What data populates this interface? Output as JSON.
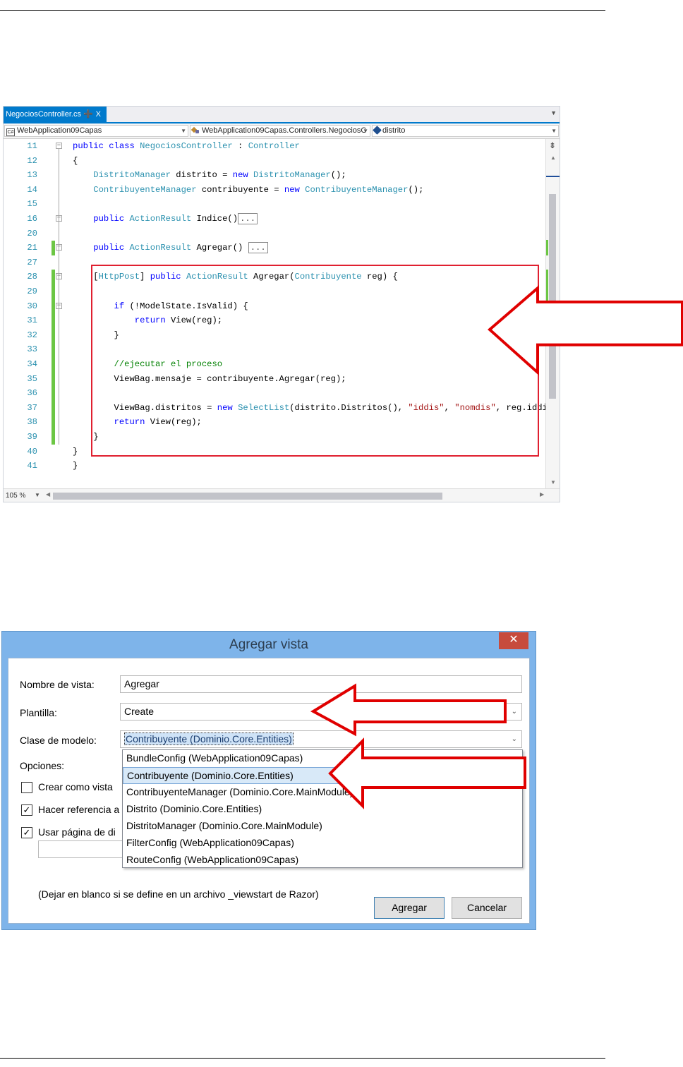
{
  "editor": {
    "tab": {
      "filename": "NegociosController.cs",
      "pin": "➕",
      "close": "X"
    },
    "nav": {
      "project": "WebApplication09Capas",
      "class": "WebApplication09Capas.Controllers.NegociosC",
      "member": "distrito"
    },
    "zoom": "105 %",
    "lines": [
      {
        "n": "11",
        "segments": [
          {
            "t": "public class ",
            "c": "kw"
          },
          {
            "t": "NegociosController",
            "c": "ty"
          },
          {
            "t": " : ",
            "c": ""
          },
          {
            "t": "Controller",
            "c": "ty"
          }
        ]
      },
      {
        "n": "12",
        "segments": [
          {
            "t": "{",
            "c": ""
          }
        ]
      },
      {
        "n": "13",
        "segments": [
          {
            "t": "    ",
            "c": ""
          },
          {
            "t": "DistritoManager",
            "c": "ty"
          },
          {
            "t": " distrito = ",
            "c": ""
          },
          {
            "t": "new ",
            "c": "kw"
          },
          {
            "t": "DistritoManager",
            "c": "ty"
          },
          {
            "t": "();",
            "c": ""
          }
        ]
      },
      {
        "n": "14",
        "segments": [
          {
            "t": "    ",
            "c": ""
          },
          {
            "t": "ContribuyenteManager",
            "c": "ty"
          },
          {
            "t": " contribuyente = ",
            "c": ""
          },
          {
            "t": "new ",
            "c": "kw"
          },
          {
            "t": "ContribuyenteManager",
            "c": "ty"
          },
          {
            "t": "();",
            "c": ""
          }
        ]
      },
      {
        "n": "15",
        "segments": []
      },
      {
        "n": "16",
        "segments": [
          {
            "t": "    ",
            "c": ""
          },
          {
            "t": "public ",
            "c": "kw"
          },
          {
            "t": "ActionResult",
            "c": "ty"
          },
          {
            "t": " Indice()",
            "c": ""
          },
          {
            "t": "...",
            "c": "collapsed"
          }
        ]
      },
      {
        "n": "20",
        "segments": []
      },
      {
        "n": "21",
        "segments": [
          {
            "t": "    ",
            "c": ""
          },
          {
            "t": "public ",
            "c": "kw"
          },
          {
            "t": "ActionResult",
            "c": "ty"
          },
          {
            "t": " Agregar() ",
            "c": ""
          },
          {
            "t": "...",
            "c": "collapsed"
          }
        ]
      },
      {
        "n": "27",
        "segments": []
      },
      {
        "n": "28",
        "segments": [
          {
            "t": "    [",
            "c": ""
          },
          {
            "t": "HttpPost",
            "c": "ty"
          },
          {
            "t": "] ",
            "c": ""
          },
          {
            "t": "public ",
            "c": "kw"
          },
          {
            "t": "ActionResult",
            "c": "ty"
          },
          {
            "t": " Agregar(",
            "c": ""
          },
          {
            "t": "Contribuyente",
            "c": "ty"
          },
          {
            "t": " reg) {",
            "c": ""
          }
        ]
      },
      {
        "n": "29",
        "segments": []
      },
      {
        "n": "30",
        "segments": [
          {
            "t": "        ",
            "c": ""
          },
          {
            "t": "if ",
            "c": "kw"
          },
          {
            "t": "(!ModelState.IsValid) {",
            "c": ""
          }
        ]
      },
      {
        "n": "31",
        "segments": [
          {
            "t": "            ",
            "c": ""
          },
          {
            "t": "return ",
            "c": "kw"
          },
          {
            "t": "View(reg);",
            "c": ""
          }
        ]
      },
      {
        "n": "32",
        "segments": [
          {
            "t": "        }",
            "c": ""
          }
        ]
      },
      {
        "n": "33",
        "segments": []
      },
      {
        "n": "34",
        "segments": [
          {
            "t": "        ",
            "c": ""
          },
          {
            "t": "//ejecutar el proceso",
            "c": "cm"
          }
        ]
      },
      {
        "n": "35",
        "segments": [
          {
            "t": "        ViewBag.mensaje = contribuyente.Agregar(reg);",
            "c": ""
          }
        ]
      },
      {
        "n": "36",
        "segments": []
      },
      {
        "n": "37",
        "segments": [
          {
            "t": "        ViewBag.distritos = ",
            "c": ""
          },
          {
            "t": "new ",
            "c": "kw"
          },
          {
            "t": "SelectList",
            "c": "ty"
          },
          {
            "t": "(distrito.Distritos(), ",
            "c": ""
          },
          {
            "t": "\"iddis\"",
            "c": "st"
          },
          {
            "t": ", ",
            "c": ""
          },
          {
            "t": "\"nomdis\"",
            "c": "st"
          },
          {
            "t": ", reg.iddis);",
            "c": ""
          }
        ]
      },
      {
        "n": "38",
        "segments": [
          {
            "t": "        ",
            "c": ""
          },
          {
            "t": "return ",
            "c": "kw"
          },
          {
            "t": "View(reg);",
            "c": ""
          }
        ]
      },
      {
        "n": "39",
        "segments": [
          {
            "t": "    }",
            "c": ""
          }
        ]
      },
      {
        "n": "40",
        "segments": [
          {
            "t": "}",
            "c": ""
          }
        ]
      },
      {
        "n": "41",
        "segments": [
          {
            "t": "}",
            "c": ""
          }
        ]
      }
    ]
  },
  "dialog": {
    "title": "Agregar vista",
    "close": "✕",
    "fields": {
      "nombre_label": "Nombre de vista:",
      "nombre_value": "Agregar",
      "plantilla_label": "Plantilla:",
      "plantilla_value": "Create",
      "clase_label": "Clase de modelo:",
      "clase_value": "Contribuyente (Dominio.Core.Entities)"
    },
    "opciones_label": "Opciones:",
    "options": [
      {
        "label": "Crear como vista",
        "checked": false
      },
      {
        "label": "Hacer referencia a",
        "checked": true
      },
      {
        "label": "Usar página de di",
        "checked": true
      }
    ],
    "dropdown_items": [
      "BundleConfig (WebApplication09Capas)",
      "Contribuyente (Dominio.Core.Entities)",
      "ContribuyenteManager (Dominio.Core.MainModule)",
      "Distrito (Dominio.Core.Entities)",
      "DistritoManager (Dominio.Core.MainModule)",
      "FilterConfig (WebApplication09Capas)",
      "RouteConfig (WebApplication09Capas)"
    ],
    "selected_index": 1,
    "hint_prefix": "(Dejar en blanco si",
    "hint_suffix": "se define en un archivo _viewstart de Razor)",
    "buttons": {
      "add": "Agregar",
      "cancel": "Cancelar"
    }
  },
  "colors": {
    "accent": "#007acc",
    "highlight": "#e02030",
    "dialog_frame": "#7eb4ea",
    "close_button": "#c74b3d"
  }
}
